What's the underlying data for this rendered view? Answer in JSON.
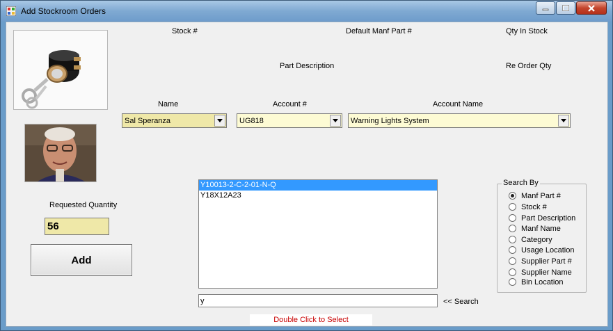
{
  "window": {
    "title": "Add Stockroom Orders"
  },
  "header_labels": {
    "stock_no": "Stock #",
    "default_manf_part": "Default Manf Part #",
    "qty_in_stock": "Qty In Stock",
    "part_description": "Part Description",
    "reorder_qty": "Re Order Qty"
  },
  "form": {
    "name_label": "Name",
    "name_value": "Sal Speranza",
    "account_label": "Account #",
    "account_value": "UG818",
    "account_name_label": "Account Name",
    "account_name_value": "Warning Lights System",
    "requested_qty_label": "Requested Quantity",
    "requested_qty_value": "56",
    "add_label": "Add"
  },
  "results": {
    "items": [
      "Y10013-2-C-2-01-N-Q",
      "Y18X12A23"
    ],
    "selected_index": 0
  },
  "search": {
    "value": "y",
    "button_label": "<< Search",
    "hint": "Double Click to Select"
  },
  "search_by": {
    "title": "Search By",
    "options": [
      "Manf Part #",
      "Stock #",
      "Part Description",
      "Manf Name",
      "Category",
      "Usage Location",
      "Supplier Part #",
      "Supplier Name",
      "Bin Location"
    ],
    "selected": "Manf Part #"
  },
  "colors": {
    "title_bar": "#7fa9d2",
    "combo_bg": "#fdfbd4",
    "qty_bg": "#efe8a8",
    "selection": "#3399ff",
    "hint_text": "#c80000"
  }
}
